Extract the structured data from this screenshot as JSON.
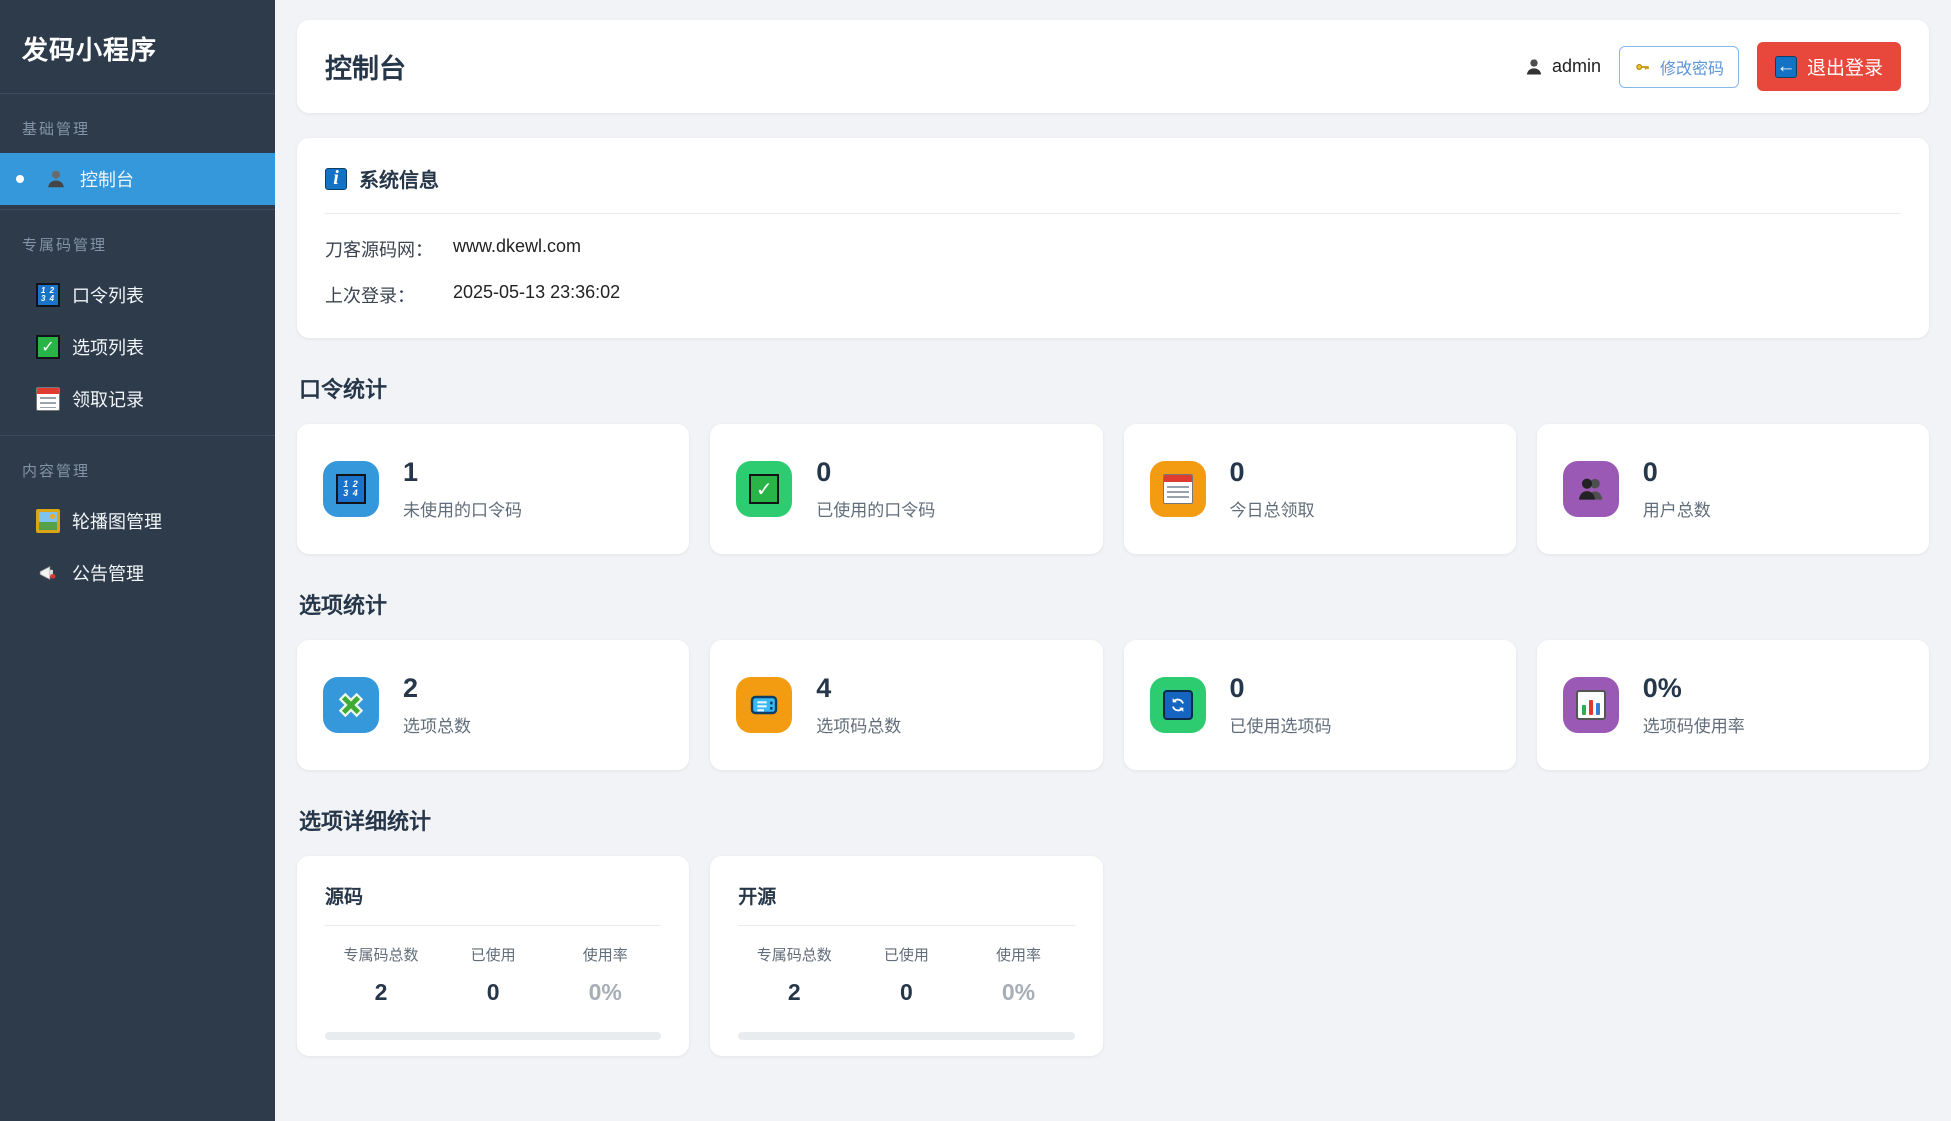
{
  "app": {
    "brand": "发码小程序"
  },
  "palette": {
    "sidebar_bg": "#2d3b4b",
    "active_item": "#3498db",
    "danger": "#e8473c",
    "tile_blue": "#3498db",
    "tile_green": "#2ecc71",
    "tile_orange": "#f39c12",
    "tile_purple": "#9b59b6",
    "page_bg": "#f1f3f6"
  },
  "sidebar": {
    "sections": [
      {
        "label": "基础管理",
        "items": [
          {
            "label": "控制台",
            "icon": "user-silhouette-icon",
            "active": true
          }
        ]
      },
      {
        "label": "专属码管理",
        "items": [
          {
            "label": "口令列表",
            "icon": "input-numbers-icon"
          },
          {
            "label": "选项列表",
            "icon": "check-mark-icon"
          },
          {
            "label": "领取记录",
            "icon": "calendar-icon"
          }
        ]
      },
      {
        "label": "内容管理",
        "items": [
          {
            "label": "轮播图管理",
            "icon": "framed-picture-icon"
          },
          {
            "label": "公告管理",
            "icon": "megaphone-icon"
          }
        ]
      }
    ]
  },
  "header": {
    "title": "控制台",
    "username": "admin",
    "change_password_label": "修改密码",
    "logout_label": "退出登录"
  },
  "system_info": {
    "title": "系统信息",
    "rows": [
      {
        "label": "刀客源码网：",
        "value": "www.dkewl.com"
      },
      {
        "label": "上次登录：",
        "value": "2025-05-13 23:36:02"
      }
    ]
  },
  "stats": [
    {
      "heading": "口令统计",
      "cards": [
        {
          "value": "1",
          "label": "未使用的口令码",
          "icon": "input-numbers-icon",
          "tile": "blue"
        },
        {
          "value": "0",
          "label": "已使用的口令码",
          "icon": "check-mark-icon",
          "tile": "green"
        },
        {
          "value": "0",
          "label": "今日总领取",
          "icon": "calendar-icon",
          "tile": "orange"
        },
        {
          "value": "0",
          "label": "用户总数",
          "icon": "busts-icon",
          "tile": "purple"
        }
      ]
    },
    {
      "heading": "选项统计",
      "cards": [
        {
          "value": "2",
          "label": "选项总数",
          "icon": "green-cross-icon",
          "tile": "blue"
        },
        {
          "value": "4",
          "label": "选项码总数",
          "icon": "ticket-icon",
          "tile": "orange"
        },
        {
          "value": "0",
          "label": "已使用选项码",
          "icon": "refresh-arrows-icon",
          "tile": "green"
        },
        {
          "value": "0%",
          "label": "选项码使用率",
          "icon": "bar-chart-icon",
          "tile": "purple"
        }
      ]
    }
  ],
  "detail": {
    "heading": "选项详细统计",
    "col_labels": [
      "专属码总数",
      "已使用",
      "使用率"
    ],
    "cards": [
      {
        "title": "源码",
        "values": [
          "2",
          "0",
          "0%"
        ]
      },
      {
        "title": "开源",
        "values": [
          "2",
          "0",
          "0%"
        ]
      }
    ]
  },
  "glyphs": {
    "check": "✓",
    "left_arrow": "←",
    "info": "i",
    "num_row1": "1 2",
    "num_row2": "3 4"
  }
}
